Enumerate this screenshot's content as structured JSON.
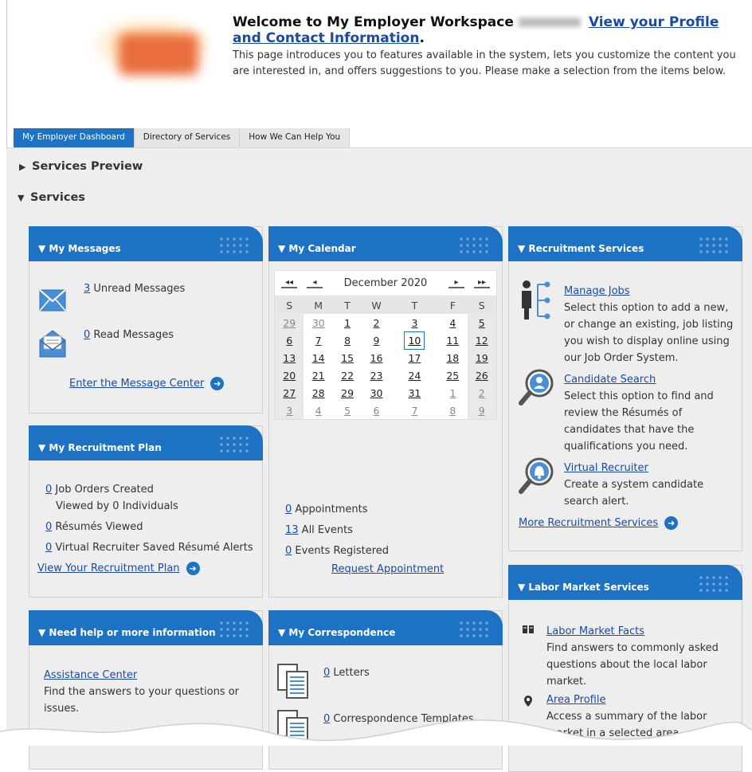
{
  "header": {
    "welcome_title": "Welcome to My Employer Workspace",
    "profile_link_1": "View your Profile",
    "profile_link_2": "and Contact Information",
    "profile_link_suffix": ".",
    "description": "This page introduces you to features available in the system, lets you customize the content you are interested in, and offers suggestions to you. Please make a selection from the items below."
  },
  "tabs": [
    {
      "label": "My Employer Dashboard"
    },
    {
      "label": "Directory of Services"
    },
    {
      "label": "How We Can Help You"
    }
  ],
  "sections": {
    "preview_label": "Services Preview",
    "services_label": "Services"
  },
  "messages": {
    "title": "My Messages",
    "unread_count": "3",
    "unread_label": " Unread Messages",
    "read_count": "0",
    "read_label": " Read Messages",
    "center_link": "Enter the Message Center"
  },
  "calendar": {
    "title": "My Calendar",
    "month": "December 2020",
    "nav_first": "◂◂",
    "nav_prev": "◂",
    "nav_next": "▸",
    "nav_last": "▸▸",
    "weekdays": [
      "S",
      "M",
      "T",
      "W",
      "T",
      "F",
      "S"
    ],
    "weeks": [
      [
        "29",
        "30",
        "1",
        "2",
        "3",
        "4",
        "5"
      ],
      [
        "6",
        "7",
        "8",
        "9",
        "10",
        "11",
        "12"
      ],
      [
        "13",
        "14",
        "15",
        "16",
        "17",
        "18",
        "19"
      ],
      [
        "20",
        "21",
        "22",
        "23",
        "24",
        "25",
        "26"
      ],
      [
        "27",
        "28",
        "29",
        "30",
        "31",
        "1",
        "2"
      ],
      [
        "3",
        "4",
        "5",
        "6",
        "7",
        "8",
        "9"
      ]
    ],
    "appointments_count": "0",
    "appointments_label": " Appointments",
    "events_count": "13",
    "events_label": " All Events",
    "registered_count": "0",
    "registered_label": " Events Registered",
    "request_link": "Request Appointment"
  },
  "recruitment_services": {
    "title": "Recruitment Services",
    "items": [
      {
        "link": "Manage Jobs",
        "desc": "Select this option to add a new, or change an existing, job listing you wish to display online using our Job Order System."
      },
      {
        "link": "Candidate Search",
        "desc": "Select this option to find and review the Résumés of candidates that have the qualifications you need."
      },
      {
        "link": "Virtual Recruiter",
        "desc": "Create a system candidate search alert."
      }
    ],
    "more_link": "More Recruitment Services"
  },
  "recruitment_plan": {
    "title": "My Recruitment Plan",
    "job_orders_count": "0",
    "job_orders_label": " Job Orders Created",
    "viewed_by": "Viewed by 0 Individuals",
    "resumes_count": "0",
    "resumes_label": " Résumés Viewed",
    "alerts_count": "0",
    "alerts_label": " Virtual Recruiter Saved Résumé Alerts",
    "plan_link": "View Your Recruitment Plan"
  },
  "labor_market": {
    "title": "Labor Market Services",
    "items": [
      {
        "link": "Labor Market Facts",
        "desc": "Find answers to commonly asked questions about the local labor market."
      },
      {
        "link": "Area Profile",
        "desc": "Access a summary of the labor market in a selected area."
      }
    ]
  },
  "help": {
    "title": "Need help or more information",
    "link": "Assistance Center",
    "desc": "Find the answers to your questions or issues."
  },
  "correspondence": {
    "title": "My Correspondence",
    "letters_count": "0",
    "letters_label": " Letters",
    "templates_count": "0",
    "templates_label": " Correspondence Templates"
  },
  "colors": {
    "accent": "#1e72c4",
    "link": "#1a4aa6",
    "panel_bg": "#eeeeee"
  }
}
